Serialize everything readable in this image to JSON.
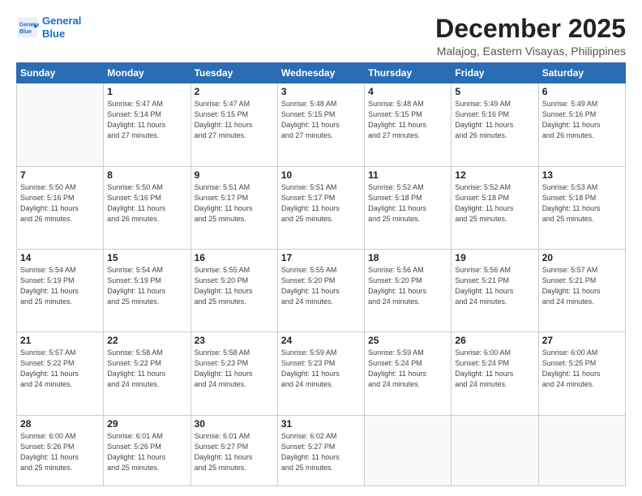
{
  "header": {
    "logo_line1": "General",
    "logo_line2": "Blue",
    "month": "December 2025",
    "location": "Malajog, Eastern Visayas, Philippines"
  },
  "weekdays": [
    "Sunday",
    "Monday",
    "Tuesday",
    "Wednesday",
    "Thursday",
    "Friday",
    "Saturday"
  ],
  "weeks": [
    [
      {
        "day": "",
        "detail": ""
      },
      {
        "day": "1",
        "detail": "Sunrise: 5:47 AM\nSunset: 5:14 PM\nDaylight: 11 hours\nand 27 minutes."
      },
      {
        "day": "2",
        "detail": "Sunrise: 5:47 AM\nSunset: 5:15 PM\nDaylight: 11 hours\nand 27 minutes."
      },
      {
        "day": "3",
        "detail": "Sunrise: 5:48 AM\nSunset: 5:15 PM\nDaylight: 11 hours\nand 27 minutes."
      },
      {
        "day": "4",
        "detail": "Sunrise: 5:48 AM\nSunset: 5:15 PM\nDaylight: 11 hours\nand 27 minutes."
      },
      {
        "day": "5",
        "detail": "Sunrise: 5:49 AM\nSunset: 5:16 PM\nDaylight: 11 hours\nand 26 minutes."
      },
      {
        "day": "6",
        "detail": "Sunrise: 5:49 AM\nSunset: 5:16 PM\nDaylight: 11 hours\nand 26 minutes."
      }
    ],
    [
      {
        "day": "7",
        "detail": "Sunrise: 5:50 AM\nSunset: 5:16 PM\nDaylight: 11 hours\nand 26 minutes."
      },
      {
        "day": "8",
        "detail": "Sunrise: 5:50 AM\nSunset: 5:16 PM\nDaylight: 11 hours\nand 26 minutes."
      },
      {
        "day": "9",
        "detail": "Sunrise: 5:51 AM\nSunset: 5:17 PM\nDaylight: 11 hours\nand 25 minutes."
      },
      {
        "day": "10",
        "detail": "Sunrise: 5:51 AM\nSunset: 5:17 PM\nDaylight: 11 hours\nand 25 minutes."
      },
      {
        "day": "11",
        "detail": "Sunrise: 5:52 AM\nSunset: 5:18 PM\nDaylight: 11 hours\nand 25 minutes."
      },
      {
        "day": "12",
        "detail": "Sunrise: 5:52 AM\nSunset: 5:18 PM\nDaylight: 11 hours\nand 25 minutes."
      },
      {
        "day": "13",
        "detail": "Sunrise: 5:53 AM\nSunset: 5:18 PM\nDaylight: 11 hours\nand 25 minutes."
      }
    ],
    [
      {
        "day": "14",
        "detail": "Sunrise: 5:54 AM\nSunset: 5:19 PM\nDaylight: 11 hours\nand 25 minutes."
      },
      {
        "day": "15",
        "detail": "Sunrise: 5:54 AM\nSunset: 5:19 PM\nDaylight: 11 hours\nand 25 minutes."
      },
      {
        "day": "16",
        "detail": "Sunrise: 5:55 AM\nSunset: 5:20 PM\nDaylight: 11 hours\nand 25 minutes."
      },
      {
        "day": "17",
        "detail": "Sunrise: 5:55 AM\nSunset: 5:20 PM\nDaylight: 11 hours\nand 24 minutes."
      },
      {
        "day": "18",
        "detail": "Sunrise: 5:56 AM\nSunset: 5:20 PM\nDaylight: 11 hours\nand 24 minutes."
      },
      {
        "day": "19",
        "detail": "Sunrise: 5:56 AM\nSunset: 5:21 PM\nDaylight: 11 hours\nand 24 minutes."
      },
      {
        "day": "20",
        "detail": "Sunrise: 5:57 AM\nSunset: 5:21 PM\nDaylight: 11 hours\nand 24 minutes."
      }
    ],
    [
      {
        "day": "21",
        "detail": "Sunrise: 5:57 AM\nSunset: 5:22 PM\nDaylight: 11 hours\nand 24 minutes."
      },
      {
        "day": "22",
        "detail": "Sunrise: 5:58 AM\nSunset: 5:22 PM\nDaylight: 11 hours\nand 24 minutes."
      },
      {
        "day": "23",
        "detail": "Sunrise: 5:58 AM\nSunset: 5:23 PM\nDaylight: 11 hours\nand 24 minutes."
      },
      {
        "day": "24",
        "detail": "Sunrise: 5:59 AM\nSunset: 5:23 PM\nDaylight: 11 hours\nand 24 minutes."
      },
      {
        "day": "25",
        "detail": "Sunrise: 5:59 AM\nSunset: 5:24 PM\nDaylight: 11 hours\nand 24 minutes."
      },
      {
        "day": "26",
        "detail": "Sunrise: 6:00 AM\nSunset: 5:24 PM\nDaylight: 11 hours\nand 24 minutes."
      },
      {
        "day": "27",
        "detail": "Sunrise: 6:00 AM\nSunset: 5:25 PM\nDaylight: 11 hours\nand 24 minutes."
      }
    ],
    [
      {
        "day": "28",
        "detail": "Sunrise: 6:00 AM\nSunset: 5:26 PM\nDaylight: 11 hours\nand 25 minutes."
      },
      {
        "day": "29",
        "detail": "Sunrise: 6:01 AM\nSunset: 5:26 PM\nDaylight: 11 hours\nand 25 minutes."
      },
      {
        "day": "30",
        "detail": "Sunrise: 6:01 AM\nSunset: 5:27 PM\nDaylight: 11 hours\nand 25 minutes."
      },
      {
        "day": "31",
        "detail": "Sunrise: 6:02 AM\nSunset: 5:27 PM\nDaylight: 11 hours\nand 25 minutes."
      },
      {
        "day": "",
        "detail": ""
      },
      {
        "day": "",
        "detail": ""
      },
      {
        "day": "",
        "detail": ""
      }
    ]
  ]
}
